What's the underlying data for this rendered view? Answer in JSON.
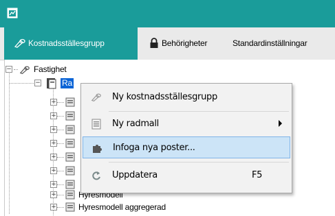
{
  "window": {
    "app_icon": "app-window-icon"
  },
  "tabs": [
    {
      "label": "Kostnadsställesgrupp",
      "icon": "key-pen-icon",
      "active": true
    },
    {
      "label": "Behörigheter",
      "icon": "padlock-icon",
      "active": false
    },
    {
      "label": "Standardinställningar",
      "active": false
    }
  ],
  "tree": {
    "root": {
      "label": "Fastighet",
      "expander": "−"
    },
    "selected_node": {
      "label": "Ra",
      "expander": "−"
    },
    "children_expander": "+",
    "visible_children": [
      {
        "label": "Hyresmodell"
      },
      {
        "label": "Hyresmodell aggregerad"
      }
    ]
  },
  "context_menu": {
    "items": [
      {
        "label": "Ny kostnadsställesgrupp",
        "icon": "key-pen-icon"
      },
      {
        "label": "Ny radmall",
        "icon": "document-icon",
        "submenu": true
      },
      {
        "label": "Infoga nya poster...",
        "icon": "puzzle-icon",
        "highlighted": true
      },
      {
        "label": "Uppdatera",
        "icon": "refresh-icon",
        "shortcut": "F5"
      }
    ]
  },
  "colors": {
    "accent": "#1a9c9a",
    "selection": "#0a64d6",
    "menu_highlight": "#cce4f7"
  }
}
